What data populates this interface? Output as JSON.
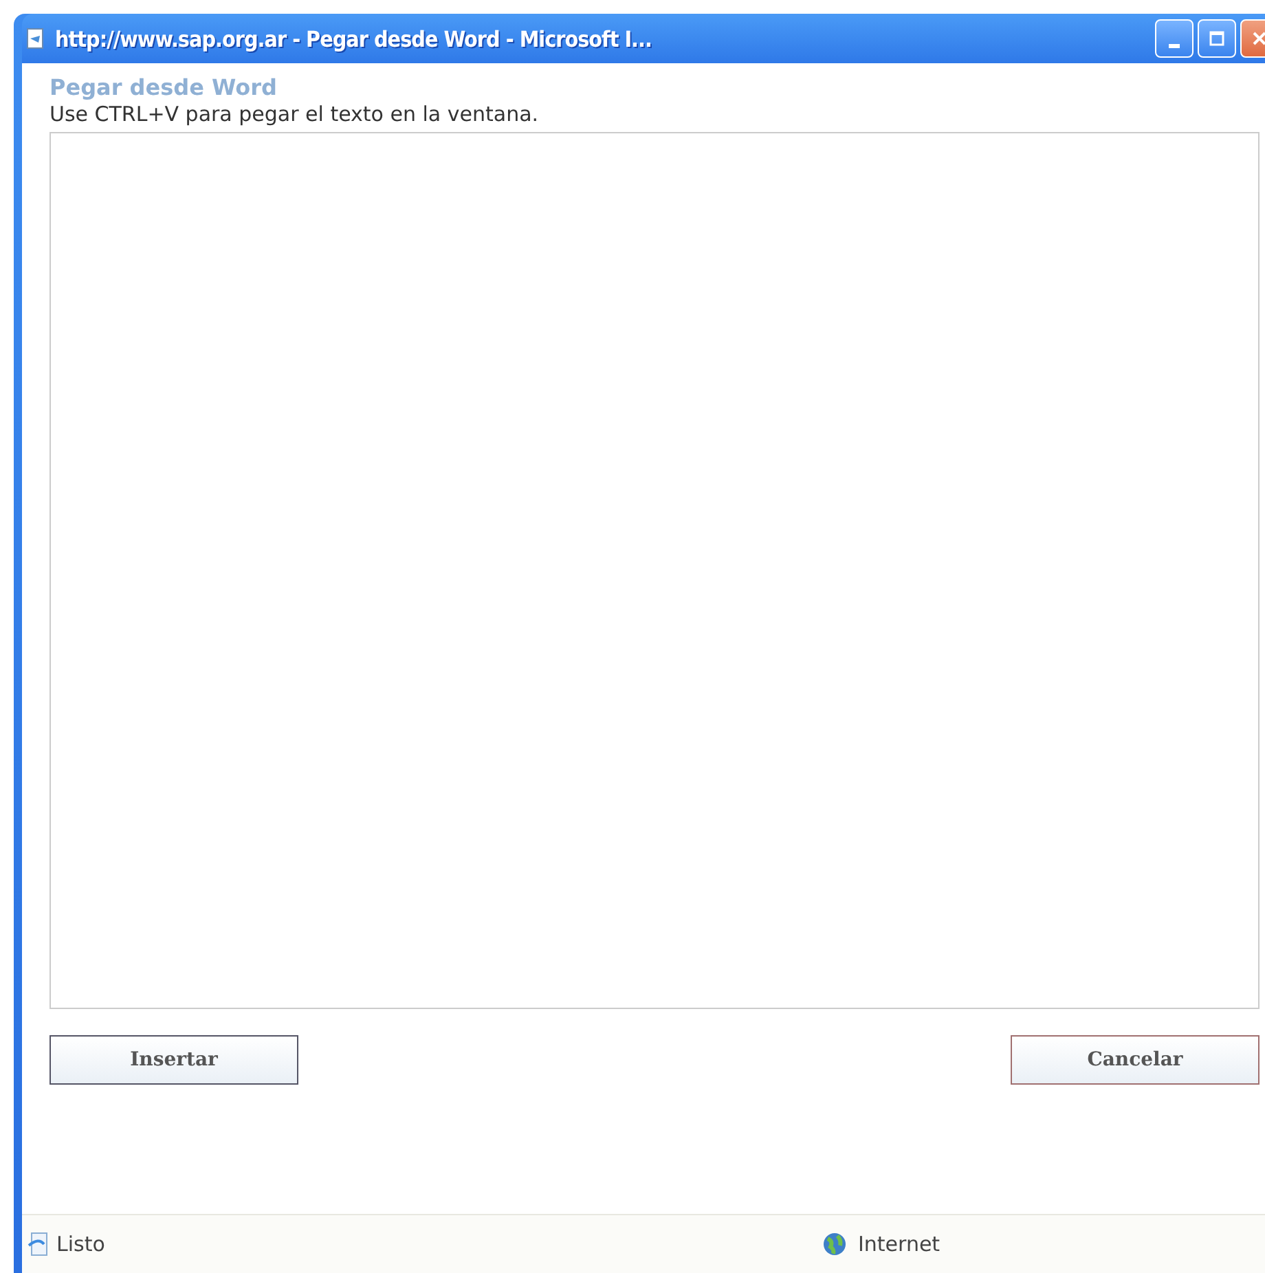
{
  "window": {
    "title": "http://www.sap.org.ar - Pegar desde Word - Microsoft I..."
  },
  "dialog": {
    "title": "Pegar desde Word",
    "instructions": "Use CTRL+V para pegar el texto en la ventana."
  },
  "buttons": [
    {
      "label": "Insertar",
      "kind": "primary"
    },
    {
      "label": "Cancelar",
      "kind": "cancel"
    }
  ],
  "status_bar": {
    "status": "Listo",
    "zone": "Internet"
  }
}
